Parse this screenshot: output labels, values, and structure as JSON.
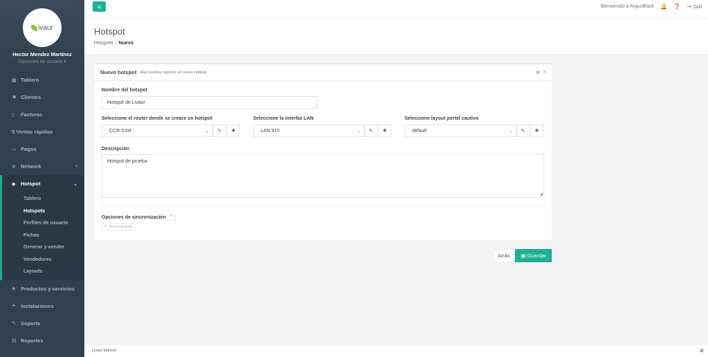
{
  "brand": {
    "logo_text": "ivaur",
    "accent": "#1ab394",
    "sidebar_bg": "#2f4050"
  },
  "user": {
    "name": "Hector Mendez Martínez",
    "menu": "Opciones de usuario ▾"
  },
  "sidebar": {
    "items": [
      {
        "label": "Tablero",
        "icon": "dashboard-icon"
      },
      {
        "label": "Clientes",
        "icon": "users-icon"
      },
      {
        "label": "Facturas",
        "icon": "file-icon"
      },
      {
        "label": "$ Ventas rápidas",
        "icon": ""
      },
      {
        "label": "Pagos",
        "icon": "money-icon"
      },
      {
        "label": "Network",
        "icon": "network-icon"
      },
      {
        "label": "Hotspot",
        "icon": "wifi-icon"
      },
      {
        "label": "Productos y servicios",
        "icon": "tag-icon"
      },
      {
        "label": "Instalaciones",
        "icon": "wrench-icon"
      },
      {
        "label": "Soporte",
        "icon": "tool-icon"
      },
      {
        "label": "Reportes",
        "icon": "book-icon"
      }
    ],
    "hotspot_sub": [
      {
        "label": "Tablero"
      },
      {
        "label": "Hotspots"
      },
      {
        "label": "Perfiles de usuario"
      },
      {
        "label": "Fichas"
      },
      {
        "label": "Generar y vender"
      },
      {
        "label": "Vendedores"
      },
      {
        "label": "Layouts"
      }
    ]
  },
  "topbar": {
    "welcome": "Bienvenido a ArgusBlack",
    "logout": "Salir"
  },
  "page": {
    "title": "Hotspot",
    "breadcrumb": [
      "Hotspots",
      "Nuevo"
    ]
  },
  "panel": {
    "title": "Nuevo hotspot",
    "subtitle": "Aquí puedes registrar un nuevo hotspot",
    "name_label": "Nombre del hotspot",
    "name_value": "Hotspot de Livaur",
    "router_label": "Seleccione el router donde se creara un hotspot",
    "router_value": "CCR-S1M",
    "lan_label": "Seleccione la interfaz LAN",
    "lan_value": "LAN 915",
    "layout_label": "Seleccione layout portal cautivo",
    "layout_value": "default",
    "desc_label": "Descripción",
    "desc_value": "Hotspot de prueba",
    "sync_label": "Opciones de sincronización",
    "sync_button": "Sincronizando"
  },
  "actions": {
    "back": "Atrás",
    "save": "Guardar"
  },
  "footer": {
    "text": "Livaur Internet"
  }
}
